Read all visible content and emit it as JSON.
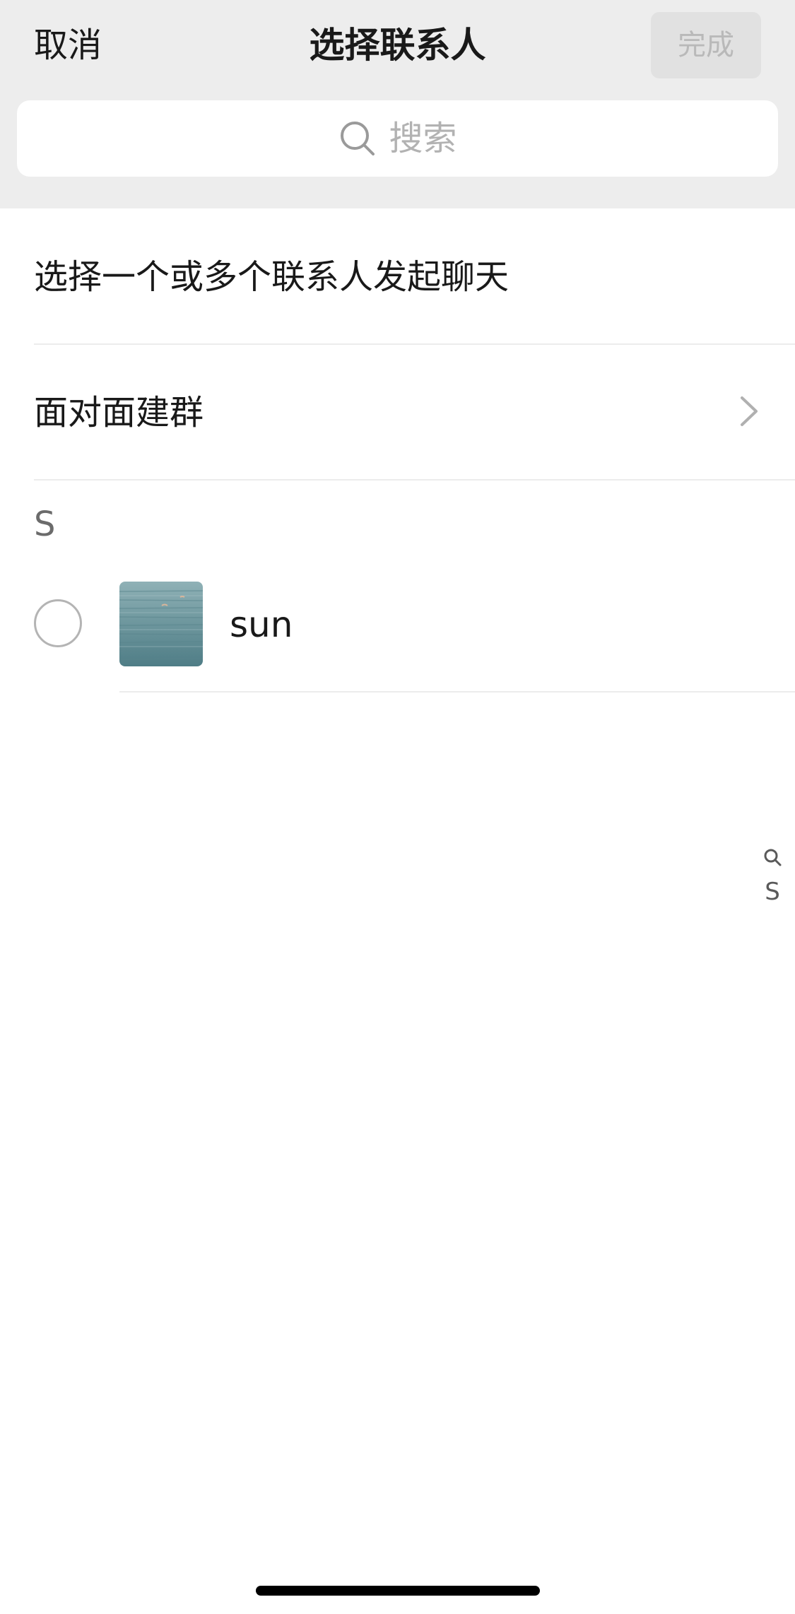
{
  "nav": {
    "cancel_label": "取消",
    "title": "选择联系人",
    "done_label": "完成"
  },
  "search": {
    "placeholder": "搜索",
    "icon": "search-icon"
  },
  "rows": {
    "start_chat": "选择一个或多个联系人发起聊天",
    "face_to_face_group": "面对面建群",
    "chevron_icon": "chevron-right-icon"
  },
  "contacts": {
    "section_letter": "S",
    "items": [
      {
        "name": "sun",
        "selected": false,
        "avatar_icon": "sea-photo-avatar"
      }
    ]
  },
  "index_bar": {
    "search_icon": "search-icon",
    "letters": [
      "S"
    ]
  },
  "colors": {
    "header_bg": "#ededed",
    "done_disabled_bg": "#e1e1e1",
    "done_disabled_text": "#b9b9b9",
    "placeholder_text": "#b2b2b2"
  }
}
